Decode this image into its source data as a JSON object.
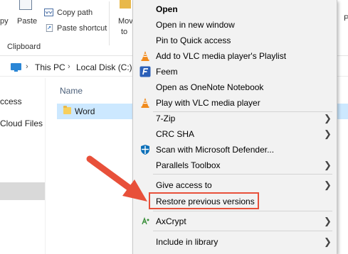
{
  "ribbon": {
    "copy_label": "Copy",
    "paste_label": "Paste",
    "copy_path_label": "Copy path",
    "paste_shortcut_label": "Paste shortcut",
    "clipboard_group_label": "Clipboard",
    "move_to_label_part1": "Mov",
    "move_to_label_part2": "to",
    "left_clip": "py"
  },
  "address": {
    "crumbs": [
      "This PC",
      "Local Disk (C:)"
    ]
  },
  "nav": {
    "items": [
      "ccess",
      "Cloud Files"
    ]
  },
  "file_list": {
    "column_name": "Name",
    "rows": [
      {
        "name": "Word"
      }
    ]
  },
  "right_edge_char": "P",
  "context_menu": {
    "items": [
      {
        "label": "Open",
        "icon": "none",
        "submenu": false
      },
      {
        "label": "Open in new window",
        "icon": "none",
        "submenu": false
      },
      {
        "label": "Pin to Quick access",
        "icon": "none",
        "submenu": false
      },
      {
        "label": "Add to VLC media player's Playlist",
        "icon": "vlc-cone-icon",
        "submenu": false
      },
      {
        "label": "Feem",
        "icon": "feem-icon",
        "submenu": false
      },
      {
        "label": "Open as OneNote Notebook",
        "icon": "none",
        "submenu": false
      },
      {
        "label": "Play with VLC media player",
        "icon": "vlc-cone-icon",
        "submenu": false
      },
      {
        "label": "7-Zip",
        "icon": "none",
        "submenu": true
      },
      {
        "label": "CRC SHA",
        "icon": "none",
        "submenu": true
      },
      {
        "label": "Scan with Microsoft Defender...",
        "icon": "defender-shield-icon",
        "submenu": false
      },
      {
        "label": "Parallels Toolbox",
        "icon": "none",
        "submenu": true
      },
      {
        "label": "Give access to",
        "icon": "none",
        "submenu": true
      },
      {
        "label": "Restore previous versions",
        "icon": "none",
        "submenu": false
      },
      {
        "label": "AxCrypt",
        "icon": "axcrypt-icon",
        "submenu": true
      },
      {
        "label": "Include in library",
        "icon": "none",
        "submenu": true
      }
    ]
  },
  "colors": {
    "menu_bg": "#f2f2f2",
    "selection_bg": "#cce8ff",
    "annotation_red": "#e8503a",
    "vlc_orange": "#f08a1c",
    "feem_blue": "#2b5fb8",
    "defender_blue": "#0b6fb8",
    "axcrypt_green": "#3a8f3a"
  }
}
